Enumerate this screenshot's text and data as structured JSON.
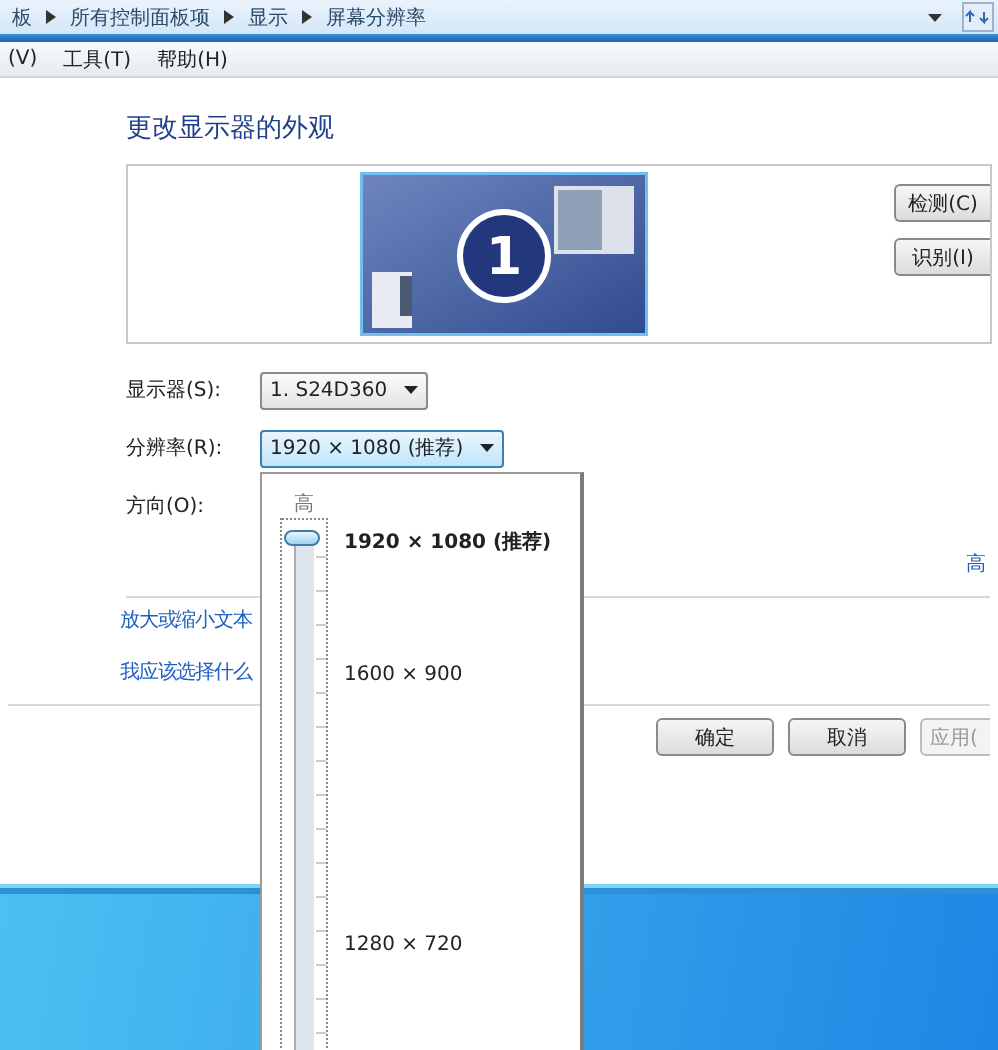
{
  "address_bar": {
    "breadcrumbs": [
      "板",
      "所有控制面板项",
      "显示",
      "屏幕分辨率"
    ]
  },
  "menu_bar": {
    "items": [
      "(V)",
      "工具(T)",
      "帮助(H)"
    ]
  },
  "heading": "更改显示器的外观",
  "preview": {
    "monitor_number": "1",
    "buttons": [
      {
        "label": "检测(C)"
      },
      {
        "label": "识别(I)"
      }
    ]
  },
  "fields": [
    {
      "label": "显示器(S):",
      "value": "1. S24D360",
      "open": false
    },
    {
      "label": "分辨率(R):",
      "value": "1920 × 1080 (推荐)",
      "open": true
    },
    {
      "label": "方向(O):"
    }
  ],
  "advanced_link": "高",
  "links": [
    "放大或缩小文本",
    "我应该选择什么"
  ],
  "buttons": [
    {
      "label": "确定",
      "disabled": false
    },
    {
      "label": "取消",
      "disabled": false
    },
    {
      "label": "应用(",
      "disabled": true
    }
  ],
  "resolution_popup": {
    "top_label": "高",
    "level": 1,
    "options": [
      {
        "label": "1920 × 1080 (推荐)",
        "selected": true
      },
      {
        "label": "1600 × 900",
        "selected": false
      },
      {
        "label": "1280 × 720",
        "selected": false
      }
    ]
  }
}
